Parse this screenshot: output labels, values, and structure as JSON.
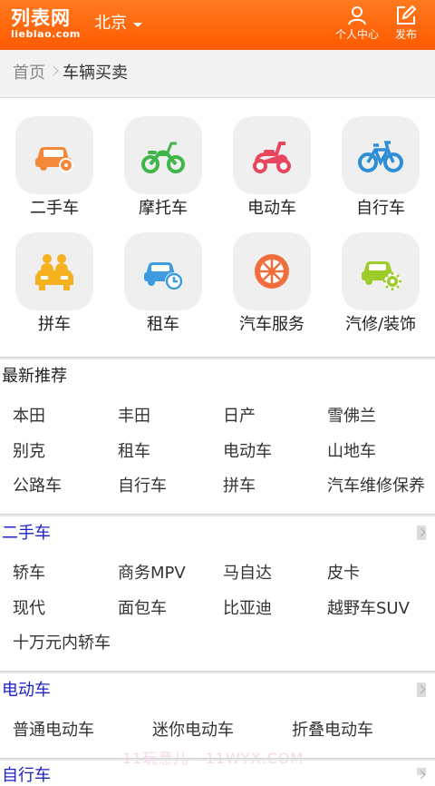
{
  "header": {
    "logo_main": "列表网",
    "logo_sub": "lieblao.com",
    "city": "北京",
    "user_label": "个人中心",
    "post_label": "发布"
  },
  "breadcrumb": {
    "home": "首页",
    "current": "车辆买卖"
  },
  "categories": [
    {
      "label": "二手车",
      "icon": "car-icon",
      "color": "#f3883a"
    },
    {
      "label": "摩托车",
      "icon": "motorcycle-icon",
      "color": "#3fb54a"
    },
    {
      "label": "电动车",
      "icon": "scooter-icon",
      "color": "#e8455e"
    },
    {
      "label": "自行车",
      "icon": "bicycle-icon",
      "color": "#2f8fd6"
    },
    {
      "label": "拼车",
      "icon": "carpool-icon",
      "color": "#f5b120"
    },
    {
      "label": "租车",
      "icon": "car-rental-icon",
      "color": "#3d9be0"
    },
    {
      "label": "汽车服务",
      "icon": "wheel-icon",
      "color": "#f06e3c"
    },
    {
      "label": "汽修/装饰",
      "icon": "car-repair-icon",
      "color": "#9ccc2a"
    }
  ],
  "recommend": {
    "title": "最新推荐",
    "items": [
      "本田",
      "丰田",
      "日产",
      "雪佛兰",
      "别克",
      "租车",
      "电动车",
      "山地车",
      "公路车",
      "自行车",
      "拼车",
      "汽车维修保养"
    ]
  },
  "used_car": {
    "title": "二手车",
    "items": [
      "轿车",
      "商务MPV",
      "马自达",
      "皮卡",
      "现代",
      "面包车",
      "比亚迪",
      "越野车SUV",
      "十万元内轿车"
    ]
  },
  "ebike": {
    "title": "电动车",
    "items": [
      "普通电动车",
      "迷你电动车",
      "折叠电动车"
    ]
  },
  "bicycle": {
    "title": "自行车"
  },
  "watermark": "11玩意儿 · 11WYX.COM",
  "colors": {
    "header": "#ff6a00",
    "section_link": "#1d22c8"
  }
}
